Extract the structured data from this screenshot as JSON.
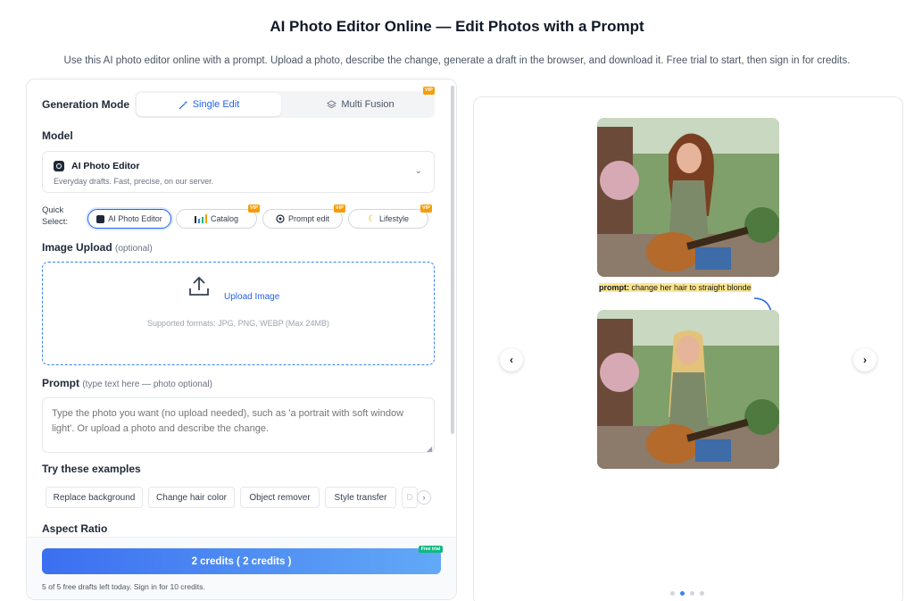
{
  "page": {
    "title": "AI Photo Editor Online — Edit Photos with a Prompt",
    "subtitle": "Use this AI photo editor online with a prompt. Upload a photo, describe the change, generate a draft in the browser, and download it. Free trial to start, then sign in for credits."
  },
  "generation_mode": {
    "label": "Generation Mode",
    "options": [
      "Single Edit",
      "Multi Fusion"
    ],
    "selected": "Single Edit",
    "vip_badge": "VIP"
  },
  "model": {
    "label": "Model",
    "name": "AI Photo Editor",
    "description": "Everyday drafts. Fast, precise, on our server."
  },
  "quick_select": {
    "label_line1": "Quick",
    "label_line2": "Select:",
    "chips": [
      {
        "label": "AI Photo Editor",
        "vip": false
      },
      {
        "label": "Catalog",
        "vip": true
      },
      {
        "label": "Prompt edit",
        "vip": true
      },
      {
        "label": "Lifestyle",
        "vip": true
      }
    ],
    "vip_badge": "VIP"
  },
  "image_upload": {
    "label": "Image Upload",
    "optional": "(optional)",
    "action": "Upload Image",
    "formats": "Supported formats: JPG, PNG, WEBP (Max 24MB)"
  },
  "prompt": {
    "label": "Prompt",
    "hint": "(type text here — photo optional)",
    "placeholder": "Type the photo you want (no upload needed), such as 'a portrait with soft window light'. Or upload a photo and describe the change."
  },
  "examples": {
    "label": "Try these examples",
    "items": [
      "Replace background",
      "Change hair color",
      "Object remover",
      "Style transfer",
      "D"
    ]
  },
  "aspect_ratio": {
    "label": "Aspect Ratio"
  },
  "generate": {
    "button": "2 credits ( 2 credits )",
    "badge": "Free trial",
    "note": "5 of 5 free drafts left today. Sign in for 10 credits."
  },
  "showcase": {
    "prompt_key": "prompt:",
    "prompt_text": " change her hair to straight blonde",
    "prev": "‹",
    "next": "›",
    "dots": 4,
    "active_dot": 1
  },
  "colors": {
    "accent": "#2563eb",
    "vip": "#f59e0b",
    "free_badge": "#10b981"
  }
}
